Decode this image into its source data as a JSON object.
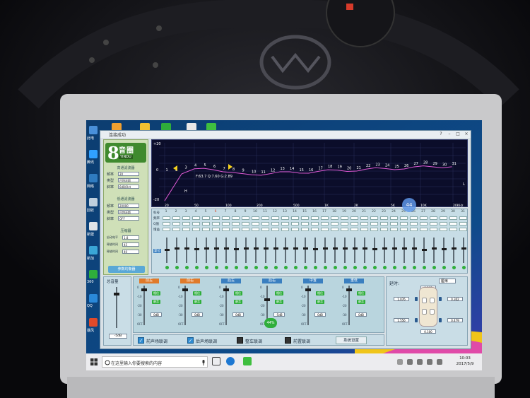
{
  "window": {
    "title": "连接成功",
    "buttons": [
      "?",
      "–",
      "□",
      "×"
    ]
  },
  "desktop_icons": [
    {
      "label": "此电",
      "color": "#4a90d9"
    },
    {
      "label": "腾讯",
      "color": "#30a0ff"
    },
    {
      "label": "网络",
      "color": "#2f7bbf"
    },
    {
      "label": "回收",
      "color": "#bfcfdd"
    },
    {
      "label": "新建",
      "color": "#e0e4e8"
    },
    {
      "label": "新加",
      "color": "#3aa6d6"
    },
    {
      "label": "360",
      "color": "#2fae3b"
    },
    {
      "label": "QQ",
      "color": "#2a88d8"
    },
    {
      "label": "暴风",
      "color": "#e04a2a"
    }
  ],
  "left_panel": {
    "brand_number": "8",
    "brand_name": "音圈",
    "brand_sub": "YINDU",
    "hp_title": "高通滤波器",
    "hp_fields": [
      {
        "label": "频率",
        "value": "20"
      },
      {
        "label": "类型",
        "value": "巴特沃斯"
      },
      {
        "label": "斜率",
        "value": "6dB/Oct"
      }
    ],
    "lp_title": "低通滤波器",
    "lp_fields": [
      {
        "label": "频率",
        "value": "20000"
      },
      {
        "label": "类型",
        "value": "巴特沃斯"
      },
      {
        "label": "斜率",
        "value": "OFF"
      }
    ],
    "limiter_title": "压缩器",
    "limiter_fields": [
      {
        "label": "启动电平",
        "value": "1.8"
      },
      {
        "label": "释放时间",
        "value": "45"
      },
      {
        "label": "释放时间",
        "value": "40"
      }
    ],
    "eq_button": "参数均衡器"
  },
  "graph": {
    "y_top": "+20",
    "y_bottom": "-20",
    "point_labels": [
      "0",
      "1",
      "2",
      "3",
      "4",
      "5",
      "6",
      "7",
      "8",
      "9",
      "10",
      "11",
      "12",
      "13",
      "14",
      "15",
      "16",
      "17",
      "18",
      "19",
      "20",
      "21",
      "22",
      "23",
      "24",
      "25",
      "26",
      "27",
      "28",
      "29",
      "30",
      "31"
    ],
    "readout": "F:63.7 Q:7.60 G:2.89",
    "h_label": "H",
    "l_label": "L",
    "freq_ticks": [
      "20",
      "50",
      "100",
      "200",
      "500",
      "1K",
      "2K",
      "5K",
      "10K",
      "20KHz"
    ],
    "curve_color": "#e05ad6"
  },
  "grid": {
    "row_labels": [
      "标号",
      "频率",
      "Q值",
      "增益"
    ],
    "channels": [
      "1",
      "2",
      "3",
      "4",
      "5",
      "6",
      "7",
      "8",
      "9",
      "10",
      "11",
      "12",
      "13",
      "14",
      "15",
      "16",
      "17",
      "18",
      "19",
      "20",
      "21",
      "22",
      "23",
      "24",
      "25",
      "26",
      "27",
      "28",
      "29",
      "30",
      "31"
    ],
    "reset_label": "复位",
    "slider_levels": [
      0.55,
      0.6,
      0.6,
      0.58,
      0.62,
      0.6,
      0.6,
      0.58,
      0.6,
      0.6,
      0.6,
      0.6,
      0.62,
      0.6,
      0.6,
      0.58,
      0.6,
      0.6,
      0.62,
      0.6,
      0.6,
      0.58,
      0.6,
      0.62,
      0.6,
      0.6,
      0.55,
      0.6,
      0.58,
      0.6,
      0.6
    ]
  },
  "master": {
    "label": "总音量",
    "value": "-5dB"
  },
  "channels": [
    {
      "name": "前左",
      "color": "#e07a2a",
      "value": "0dB"
    },
    {
      "name": "前右",
      "color": "#e07a2a",
      "value": "0dB"
    },
    {
      "name": "后左",
      "color": "#3a7fc0",
      "value": "0dB"
    },
    {
      "name": "后右",
      "color": "#3a7fc0",
      "value": "-5dB"
    },
    {
      "name": "中置",
      "color": "#3a7fc0",
      "value": "0dB"
    },
    {
      "name": "重低",
      "color": "#3a7fc0",
      "value": "0dB"
    }
  ],
  "scale_marks": [
    "0",
    "-10",
    "-20",
    "-30",
    "OFF"
  ],
  "channel_ctrl": {
    "phase": "相位",
    "mute": "静音"
  },
  "delay": {
    "label": "延时:",
    "unit_select": "厘米",
    "values": [
      "0.368",
      "1.076",
      "0.302",
      "1.556",
      "0.479",
      "0.100"
    ]
  },
  "checks": [
    {
      "label": "前声场联调",
      "checked": true
    },
    {
      "label": "后声场联调",
      "checked": true
    },
    {
      "label": "整车联调",
      "checked": false
    },
    {
      "label": "前置联调",
      "checked": false
    }
  ],
  "system_button": "系统设置",
  "bubble": "44",
  "bubble2": "44%",
  "taskbar": {
    "search_placeholder": "在这里输入你要搜索的内容",
    "time": "10:03",
    "date": "2017/5/9"
  }
}
